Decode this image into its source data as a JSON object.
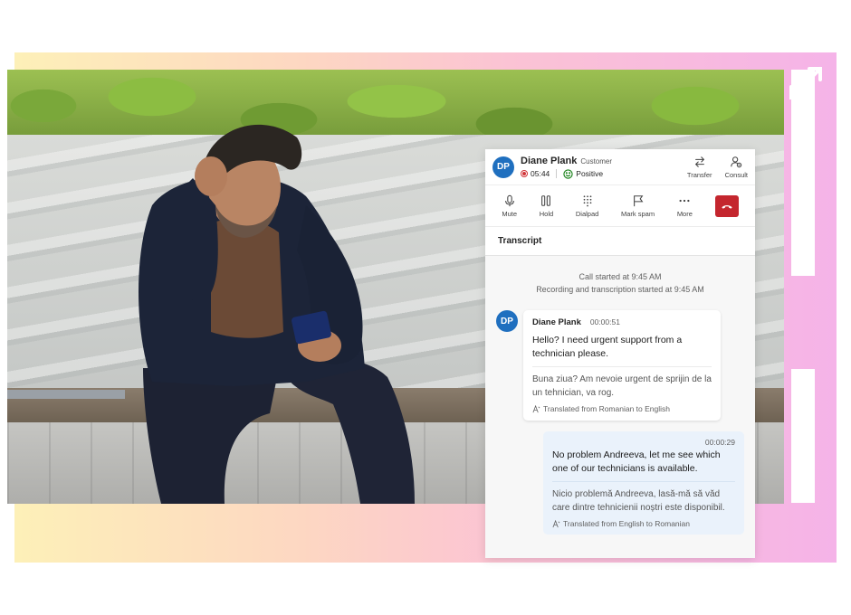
{
  "window": {
    "dots": 3
  },
  "call": {
    "avatar_initials": "DP",
    "caller_name": "Diane Plank",
    "caller_role": "Customer",
    "duration": "05:44",
    "sentiment": "Positive",
    "header_actions": [
      {
        "label": "Transfer",
        "icon": "transfer-icon"
      },
      {
        "label": "Consult",
        "icon": "consult-icon"
      }
    ],
    "toolbar": [
      {
        "label": "Mute",
        "icon": "microphone-icon"
      },
      {
        "label": "Hold",
        "icon": "pause-icon"
      },
      {
        "label": "Dialpad",
        "icon": "dialpad-icon"
      },
      {
        "label": "Mark spam",
        "icon": "flag-icon"
      },
      {
        "label": "More",
        "icon": "more-icon"
      }
    ],
    "hangup_icon": "hang-up-icon",
    "colors": {
      "accent": "#1f6fbf",
      "hangup": "#c4262e",
      "recording": "#d13438",
      "positive": "#107c10"
    }
  },
  "transcript": {
    "title": "Transcript",
    "system_lines": [
      "Call started at 9:45 AM",
      "Recording and transcription started at 9:45 AM"
    ],
    "messages": [
      {
        "avatar": "DP",
        "name": "Diane Plank",
        "time": "00:00:51",
        "text": "Hello? I need urgent support from a technician please.",
        "original": "Buna ziua? Am nevoie urgent de sprijin de la un tehnician, va rog.",
        "note": "Translated from Romanian to English"
      },
      {
        "time": "00:00:29",
        "text": "No problem Andreeva, let me see which one of our technicians is available.",
        "original": "Nicio problemă Andreeva, lasă-mă să văd care dintre tehnicienii noștri este disponibil.",
        "note": "Translated from English to Romanian"
      }
    ]
  }
}
